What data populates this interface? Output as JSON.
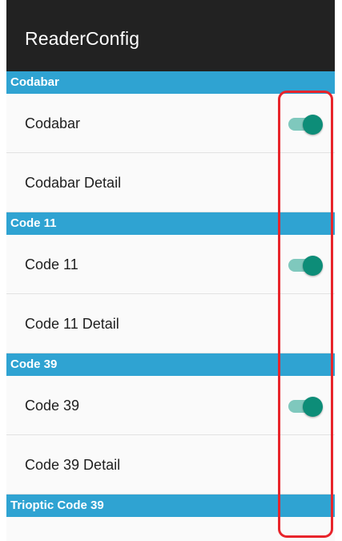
{
  "appbar": {
    "title": "ReaderConfig"
  },
  "sections": [
    {
      "header": "Codabar",
      "items": [
        {
          "label": "Codabar",
          "switch": true,
          "checked": true
        },
        {
          "label": "Codabar Detail",
          "switch": false
        }
      ]
    },
    {
      "header": "Code 11",
      "items": [
        {
          "label": "Code 11",
          "switch": true,
          "checked": true
        },
        {
          "label": "Code 11 Detail",
          "switch": false
        }
      ]
    },
    {
      "header": "Code 39",
      "items": [
        {
          "label": "Code 39",
          "switch": true,
          "checked": true
        },
        {
          "label": "Code 39 Detail",
          "switch": false
        }
      ]
    },
    {
      "header": "Trioptic Code 39",
      "items": []
    }
  ],
  "colors": {
    "appbar": "#222222",
    "section_header": "#2fa3d2",
    "switch_thumb_on": "#0d8d78",
    "switch_track_on": "#7fc8bd",
    "highlight": "#e8242b"
  }
}
